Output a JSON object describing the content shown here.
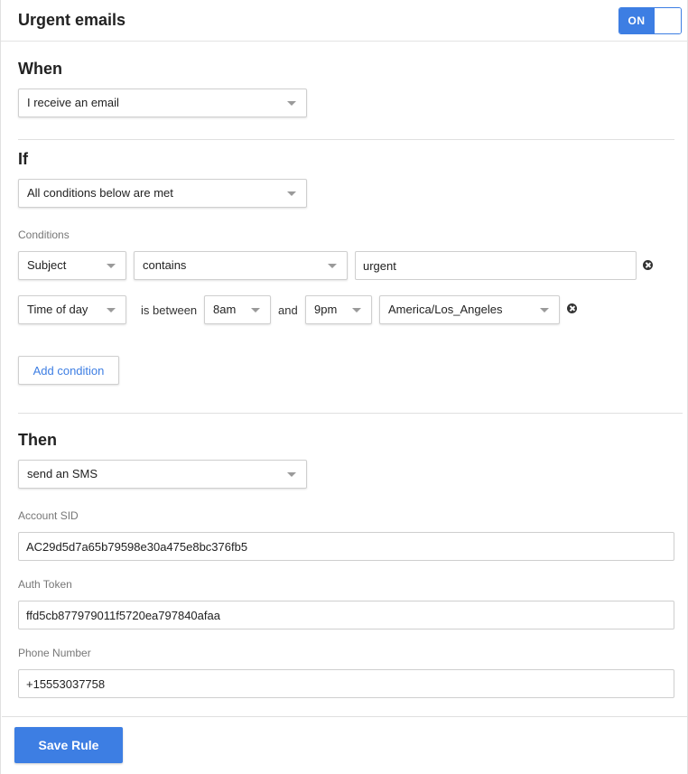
{
  "header": {
    "title": "Urgent emails",
    "toggle_label": "ON",
    "toggle_state": "on"
  },
  "when": {
    "heading": "When",
    "trigger": "I receive an email"
  },
  "if": {
    "heading": "If",
    "match_mode": "All conditions below are met",
    "conditions_label": "Conditions",
    "conditions": [
      {
        "field": "Subject",
        "operator": "contains",
        "value": "urgent"
      },
      {
        "field": "Time of day",
        "operator": "is between",
        "from": "8am",
        "joiner": "and",
        "to": "9pm",
        "timezone": "America/Los_Angeles"
      }
    ],
    "add_condition_label": "Add condition"
  },
  "then": {
    "heading": "Then",
    "action": "send an SMS",
    "fields": {
      "account_sid": {
        "label": "Account SID",
        "value": "AC29d5d7a65b79598e30a475e8bc376fb5"
      },
      "auth_token": {
        "label": "Auth Token",
        "value": "ffd5cb877979011f5720ea797840afaa"
      },
      "phone_number": {
        "label": "Phone Number",
        "value": "+15553037758"
      }
    }
  },
  "footer": {
    "save_label": "Save Rule"
  },
  "colors": {
    "accent": "#3d7ee3",
    "border": "#cfcfcf",
    "label": "#777777"
  }
}
